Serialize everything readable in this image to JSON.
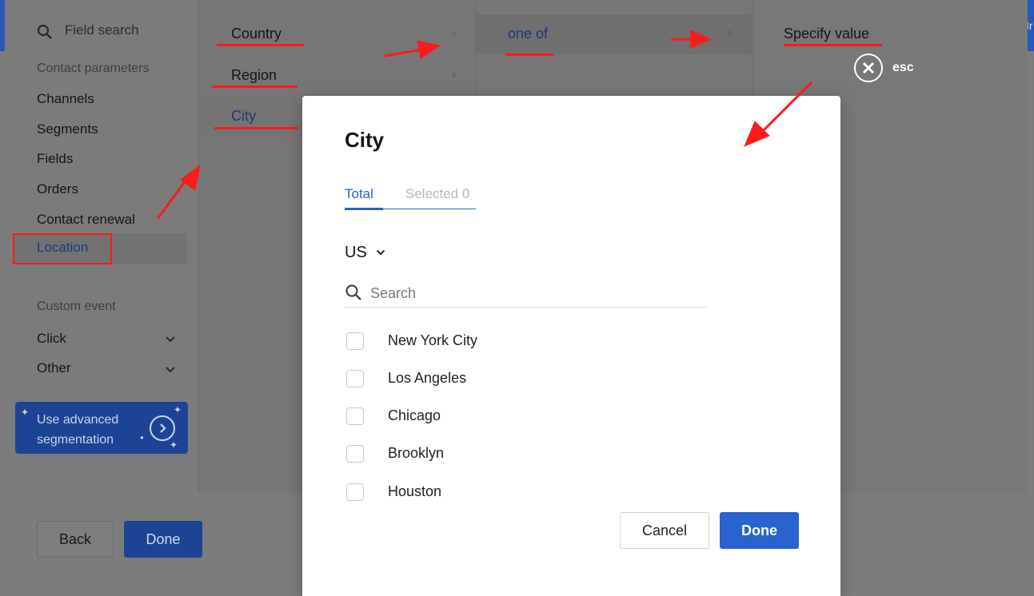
{
  "colors": {
    "accent": "#2a62cf",
    "annotation_red": "#ff1a1a",
    "header_blue": "#1e3f86"
  },
  "header": {
    "edge_text": "Ir"
  },
  "sidebar": {
    "search_placeholder": "Field search",
    "section_contact": "Contact parameters",
    "items": [
      {
        "label": "Channels"
      },
      {
        "label": "Segments"
      },
      {
        "label": "Fields"
      },
      {
        "label": "Orders"
      },
      {
        "label": "Contact renewal"
      },
      {
        "label": "Location"
      }
    ],
    "section_custom": "Custom event",
    "custom_items": [
      {
        "label": "Click"
      },
      {
        "label": "Other"
      }
    ],
    "advanced": {
      "line1": "Use advanced",
      "line2": "segmentation"
    }
  },
  "column2": {
    "items": [
      {
        "label": "Country"
      },
      {
        "label": "Region"
      },
      {
        "label": "City"
      }
    ]
  },
  "column3": {
    "item": "one of"
  },
  "column4": {
    "item": "Specify value",
    "esc_label": "esc"
  },
  "footer": {
    "back_label": "Back",
    "done_label": "Done"
  },
  "modal": {
    "title": "City",
    "tabs": [
      {
        "label": "Total",
        "active": true
      },
      {
        "label": "Selected 0",
        "active": false
      }
    ],
    "country": "US",
    "search_placeholder": "Search",
    "cities": [
      {
        "label": "New York City",
        "checked": false
      },
      {
        "label": "Los Angeles",
        "checked": false
      },
      {
        "label": "Chicago",
        "checked": false
      },
      {
        "label": "Brooklyn",
        "checked": false
      },
      {
        "label": "Houston",
        "checked": false
      }
    ],
    "cancel_label": "Cancel",
    "done_label": "Done"
  }
}
